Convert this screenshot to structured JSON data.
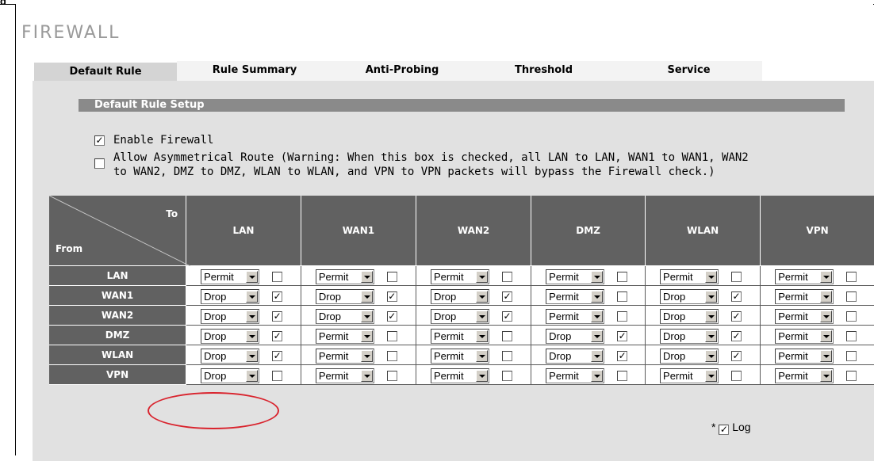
{
  "page": {
    "fragment": "g",
    "title": "FIREWALL"
  },
  "tabs": [
    {
      "label": "Default Rule",
      "active": true
    },
    {
      "label": "Rule Summary",
      "active": false
    },
    {
      "label": "Anti-Probing",
      "active": false
    },
    {
      "label": "Threshold",
      "active": false
    },
    {
      "label": "Service",
      "active": false
    }
  ],
  "section": {
    "title": "Default Rule Setup"
  },
  "options": {
    "enable_firewall": {
      "label": "Enable Firewall",
      "checked": true
    },
    "asymmetrical": {
      "line1": "Allow Asymmetrical Route (Warning: When this box is checked, all LAN to LAN, WAN1 to WAN1, WAN2",
      "line2": "to WAN2, DMZ to DMZ, WLAN to WLAN, and VPN to VPN packets will bypass the Firewall check.)",
      "checked": false
    }
  },
  "matrix": {
    "corner_to": "To",
    "corner_from": "From",
    "columns": [
      "LAN",
      "WAN1",
      "WAN2",
      "DMZ",
      "WLAN",
      "VPN"
    ],
    "rows": [
      {
        "label": "LAN",
        "cells": [
          {
            "action": "Permit",
            "log": false
          },
          {
            "action": "Permit",
            "log": false
          },
          {
            "action": "Permit",
            "log": false
          },
          {
            "action": "Permit",
            "log": false
          },
          {
            "action": "Permit",
            "log": false
          },
          {
            "action": "Permit",
            "log": false
          }
        ]
      },
      {
        "label": "WAN1",
        "cells": [
          {
            "action": "Drop",
            "log": true
          },
          {
            "action": "Drop",
            "log": true
          },
          {
            "action": "Drop",
            "log": true
          },
          {
            "action": "Permit",
            "log": false
          },
          {
            "action": "Drop",
            "log": true
          },
          {
            "action": "Permit",
            "log": false
          }
        ]
      },
      {
        "label": "WAN2",
        "cells": [
          {
            "action": "Drop",
            "log": true
          },
          {
            "action": "Drop",
            "log": true
          },
          {
            "action": "Drop",
            "log": true
          },
          {
            "action": "Permit",
            "log": false
          },
          {
            "action": "Drop",
            "log": true
          },
          {
            "action": "Permit",
            "log": false
          }
        ]
      },
      {
        "label": "DMZ",
        "cells": [
          {
            "action": "Drop",
            "log": true
          },
          {
            "action": "Permit",
            "log": false
          },
          {
            "action": "Permit",
            "log": false
          },
          {
            "action": "Drop",
            "log": true
          },
          {
            "action": "Drop",
            "log": true
          },
          {
            "action": "Permit",
            "log": false
          }
        ]
      },
      {
        "label": "WLAN",
        "cells": [
          {
            "action": "Drop",
            "log": true
          },
          {
            "action": "Permit",
            "log": false
          },
          {
            "action": "Permit",
            "log": false
          },
          {
            "action": "Drop",
            "log": true
          },
          {
            "action": "Drop",
            "log": true
          },
          {
            "action": "Permit",
            "log": false
          }
        ]
      },
      {
        "label": "VPN",
        "cells": [
          {
            "action": "Drop",
            "log": false
          },
          {
            "action": "Permit",
            "log": false
          },
          {
            "action": "Permit",
            "log": false
          },
          {
            "action": "Permit",
            "log": false
          },
          {
            "action": "Permit",
            "log": false
          },
          {
            "action": "Permit",
            "log": false
          }
        ]
      }
    ]
  },
  "legend": {
    "prefix": "*",
    "label": "Log",
    "checked": true
  },
  "colors": {
    "header_bg": "#616161",
    "panel_bg": "#e1e1e1",
    "section_bar": "#8a8a8a",
    "highlight": "#d9232d"
  }
}
